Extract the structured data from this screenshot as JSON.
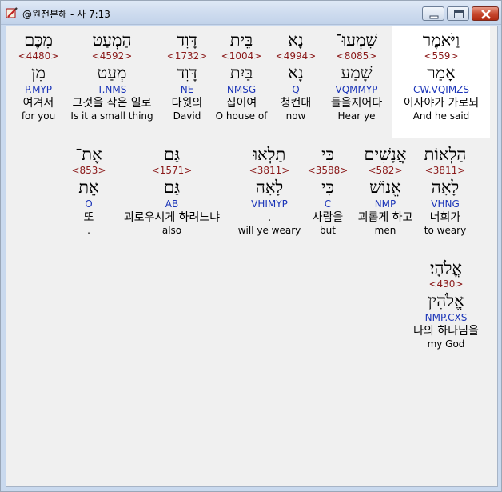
{
  "window": {
    "title": "@원전본해 - 사 7:13",
    "icon": "pen-book-icon",
    "buttons": {
      "minimize": "minimize-icon",
      "maximize": "maximize-icon",
      "close": "close-icon"
    }
  },
  "rows": [
    [
      {
        "hebrew": "וַיֹּאמֶר",
        "strong": "<559>",
        "root": "אָמַר",
        "parsing": "CW.VQIMZS",
        "korean": "이사야가 가로되",
        "english": "And he said",
        "selected": true
      },
      {
        "hebrew": "שִׁמְעוּ־",
        "strong": "<8085>",
        "root": "שָׁמַע",
        "parsing": "VQMMYP",
        "korean": "들을지어다",
        "english": "Hear ye"
      },
      {
        "hebrew": "נָא",
        "strong": "<4994>",
        "root": "נָא",
        "parsing": "Q",
        "korean": "청컨대",
        "english": "now"
      },
      {
        "hebrew": "בֵּית",
        "strong": "<1004>",
        "root": "בַּיִת",
        "parsing": "NMSG",
        "korean": "집이여",
        "english": "O house of"
      },
      {
        "hebrew": "דָּוִד",
        "strong": "<1732>",
        "root": "דָּוִד",
        "parsing": "NE",
        "korean": "다윗의",
        "english": "David"
      },
      {
        "hebrew": "הַמְעַט",
        "strong": "<4592>",
        "root": "מְעַט",
        "parsing": "T.NMS",
        "korean": "그것을 작은 일로",
        "english": "Is it a small thing"
      },
      {
        "hebrew": "מִכֶּם",
        "strong": "<4480>",
        "root": "מִן",
        "parsing": "P.MYP",
        "korean": "여겨서",
        "english": "for you"
      }
    ],
    [
      {
        "hebrew": "הַלְאוֹת",
        "strong": "<3811>",
        "root": "לָאָה",
        "parsing": "VHNG",
        "korean": "너희가",
        "english": "to weary"
      },
      {
        "hebrew": "אֲנָשִׁים",
        "strong": "<582>",
        "root": "אֱנוֹשׁ",
        "parsing": "NMP",
        "korean": "괴롭게 하고",
        "english": "men"
      },
      {
        "hebrew": "כִּי",
        "strong": "<3588>",
        "root": "כִּי",
        "parsing": "C",
        "korean": "사람을",
        "english": "but"
      },
      {
        "hebrew": "תַלְאוּ",
        "strong": "<3811>",
        "root": "לָאָה",
        "parsing": "VHIMYP",
        "korean": ".",
        "english": "will ye weary"
      },
      {
        "hebrew": "גַּם",
        "strong": "<1571>",
        "root": "גַּם",
        "parsing": "AB",
        "korean": "괴로우시게 하려느냐",
        "english": "also"
      },
      {
        "hebrew": "אֶת־",
        "strong": "<853>",
        "root": "אֵת",
        "parsing": "O",
        "korean": "또",
        "english": "."
      }
    ],
    [
      {
        "hebrew": "אֱלֹהָי׃",
        "strong": "<430>",
        "root": "אֱלֹהִין",
        "parsing": "NMP.CXS",
        "korean": "나의 하나님을",
        "english": "my God"
      }
    ]
  ]
}
